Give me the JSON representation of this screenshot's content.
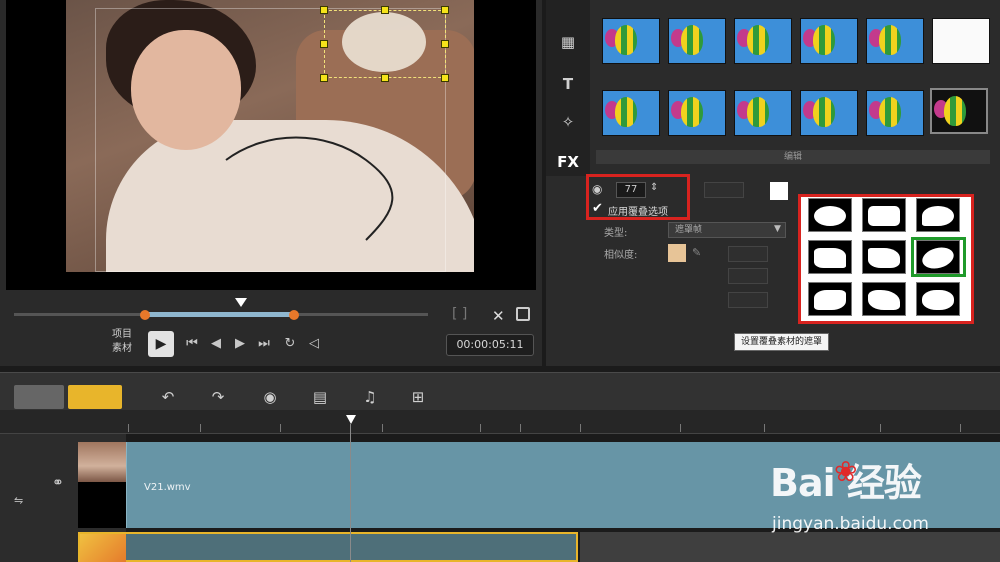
{
  "preview": {
    "timecode": "00:00:05:11",
    "mode_label_top": "项目",
    "mode_label_bottom": "素材",
    "play_glyph": "▶"
  },
  "rail_icons": [
    "▦",
    "T",
    "✧",
    "FX"
  ],
  "library": {
    "section_label": "编辑",
    "thumb_labels": [
      "",
      "",
      "",
      "",
      "",
      "",
      "",
      "",
      "",
      "",
      "",
      ""
    ]
  },
  "overlay_options": {
    "transparency_value": "77",
    "apply_overlay_label": "应用覆叠选项",
    "type_label": "类型:",
    "type_value": "遮罩帧",
    "edge_label": "相似度:",
    "tooltip": "设置覆叠素材的遮罩"
  },
  "timeline": {
    "clip_name": "V21.wmv"
  },
  "watermark": {
    "logo_text": "Bai  经验",
    "url": "jingyan.baidu.com"
  }
}
